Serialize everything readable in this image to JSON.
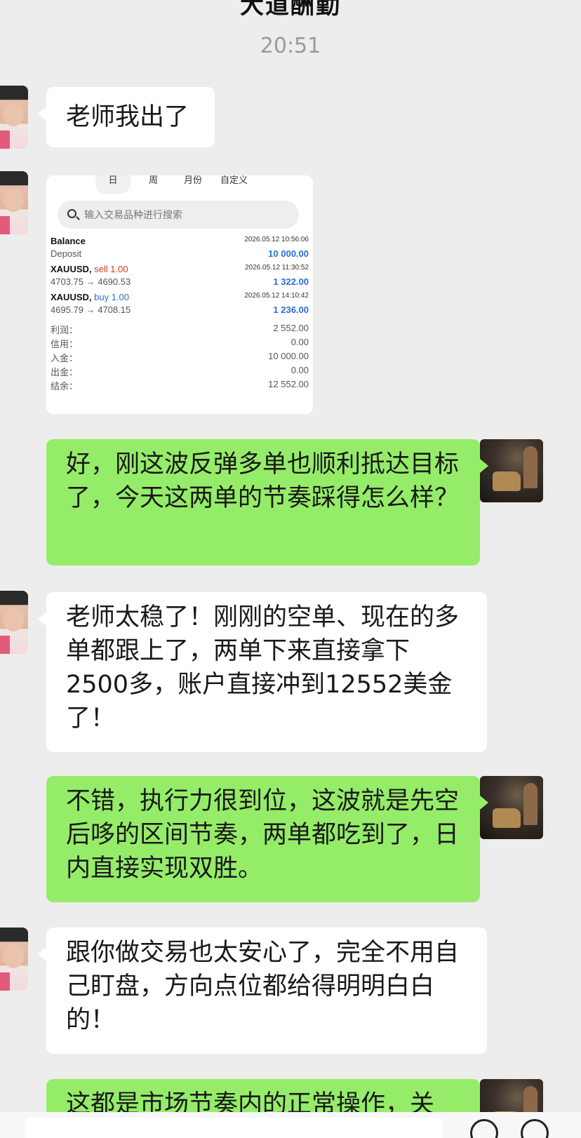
{
  "header": {
    "title": "大道酬勤"
  },
  "timestamp": "20:51",
  "messages": {
    "m1": "老师我出了",
    "m3": "好，刚这波反弹多单也顺利抵达目标了，今天这两单的节奏踩得怎么样？",
    "m4": "老师太稳了！刚刚的空单、现在的多单都跟上了，两单下来直接拿下2500多，账户直接冲到12552美金了！",
    "m5": "不错，执行力很到位，这波就是先空后哆的区间节奏，两单都吃到了，日内直接实现双胜。",
    "m6": "跟你做交易也太安心了，完全不用自己盯盘，方向点位都给得明明白白的！",
    "m7": "这都是市场节奏内的正常操作，关"
  },
  "screenshot": {
    "tabs": [
      "日",
      "周",
      "月份",
      "自定义"
    ],
    "search_placeholder": "输入交易品种进行搜索",
    "balance_label": "Balance",
    "balance_time": "2026.05.12 10:56:06",
    "deposit_label": "Deposit",
    "deposit_value": "10 000.00",
    "sell_symbol": "XAUUSD,",
    "sell_side": "sell 1.00",
    "sell_time": "2026.05.12 11:30:52",
    "sell_prices": "4703.75 → 4690.53",
    "sell_profit": "1 322.00",
    "buy_symbol": "XAUUSD,",
    "buy_side": "buy 1.00",
    "buy_time": "2026.05.12 14:10:42",
    "buy_prices": "4695.79 → 4708.15",
    "buy_profit": "1 236.00",
    "summary": [
      {
        "label": "利润：",
        "value": "2 552.00"
      },
      {
        "label": "信用：",
        "value": "0.00"
      },
      {
        "label": "入金：",
        "value": "10 000.00"
      },
      {
        "label": "出金：",
        "value": "0.00"
      },
      {
        "label": "结余：",
        "value": "12 552.00"
      }
    ]
  }
}
